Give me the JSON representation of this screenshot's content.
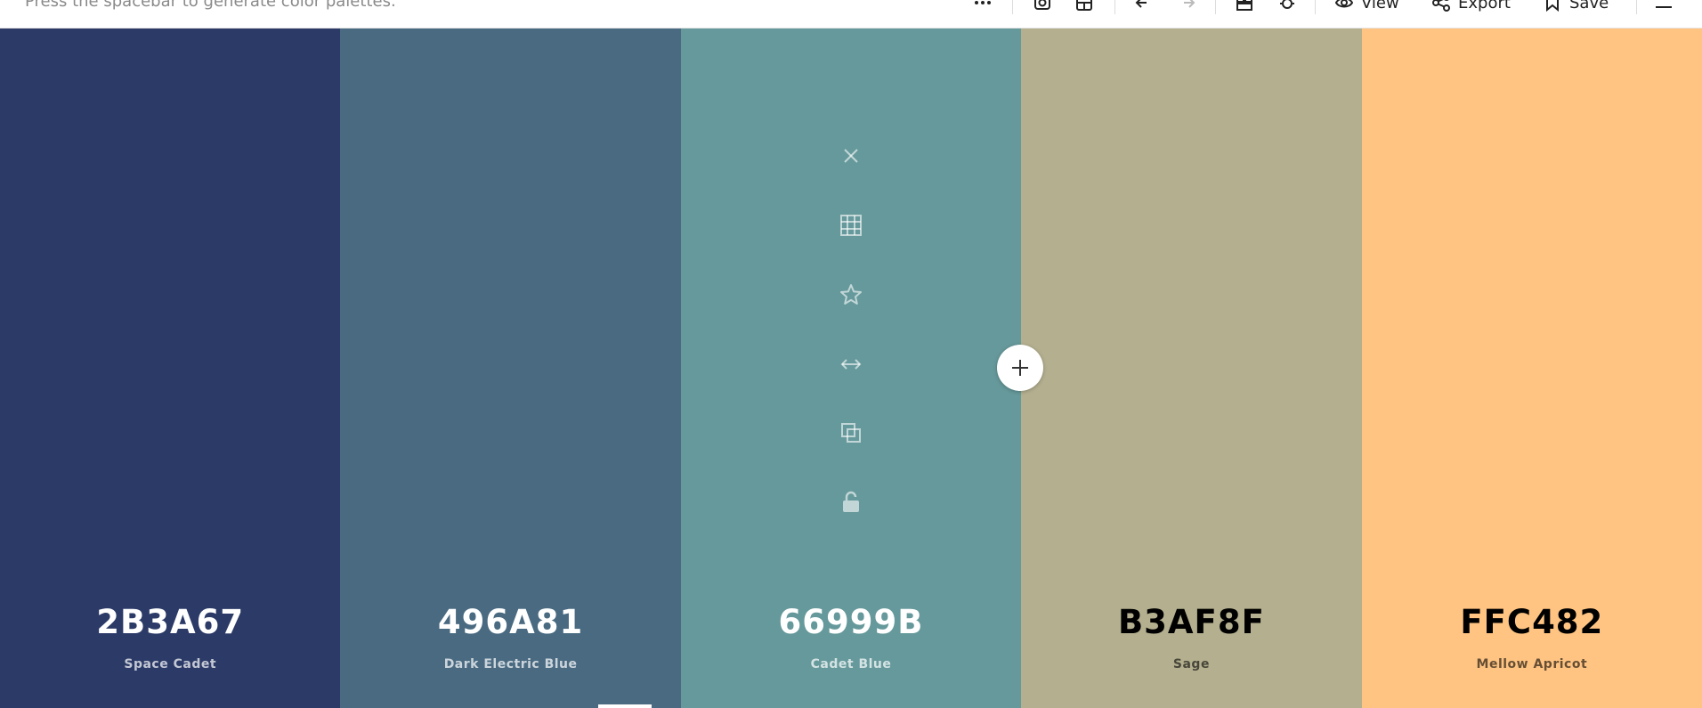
{
  "toolbar": {
    "hint": "Press the spacebar to generate color palettes.",
    "view_label": "View",
    "export_label": "Export",
    "save_label": "Save",
    "icons": [
      "more-icon",
      "camera-icon",
      "adjust-icon",
      "undo-icon",
      "redo-icon",
      "quick-view-icon",
      "lightbulb-icon",
      "eye-icon",
      "share-icon",
      "bookmark-icon",
      "menu-icon"
    ]
  },
  "palette": {
    "colors": [
      {
        "hex": "2B3A67",
        "name": "Space Cadet",
        "swatch": "#2B3A67"
      },
      {
        "hex": "496A81",
        "name": "Dark Electric Blue",
        "swatch": "#496A81"
      },
      {
        "hex": "66999B",
        "name": "Cadet Blue",
        "swatch": "#66999B"
      },
      {
        "hex": "B3AF8F",
        "name": "Sage",
        "swatch": "#B3AF8F"
      },
      {
        "hex": "FFC482",
        "name": "Mellow Apricot",
        "swatch": "#FFC482"
      }
    ],
    "hovered_column_tools": [
      "remove-color-icon",
      "shades-icon",
      "favorite-icon",
      "drag-icon",
      "copy-icon",
      "lock-icon"
    ],
    "add_color_icon": "plus-icon"
  }
}
